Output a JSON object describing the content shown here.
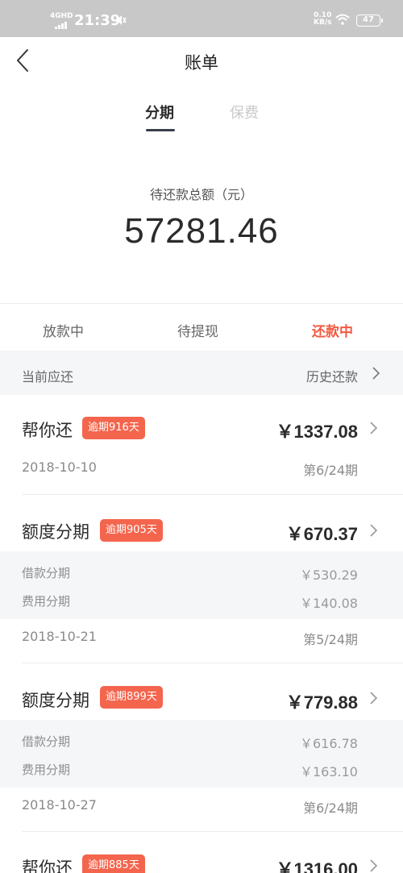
{
  "status_bar": {
    "network": "4GHD",
    "time": "21:39",
    "speed_value": "0.10",
    "speed_unit": "KB/s",
    "battery": "47"
  },
  "header": {
    "title": "账单"
  },
  "top_tabs": [
    {
      "label": "分期",
      "active": true
    },
    {
      "label": "保费",
      "active": false
    }
  ],
  "summary": {
    "label": "待还款总额（元）",
    "amount": "57281.46"
  },
  "status_tabs": [
    {
      "label": "放款中",
      "active": false
    },
    {
      "label": "待提现",
      "active": false
    },
    {
      "label": "还款中",
      "active": true
    }
  ],
  "current_section": {
    "label": "当前应还",
    "history_label": "历史还款"
  },
  "bills": [
    {
      "name": "帮你还",
      "badge": "逾期916天",
      "amount": "￥1337.08",
      "date": "2018-10-10",
      "period": "第6/24期"
    },
    {
      "name": "额度分期",
      "badge": "逾期905天",
      "amount": "￥670.37",
      "breakdown": [
        {
          "label": "借款分期",
          "value": "￥530.29"
        },
        {
          "label": "费用分期",
          "value": "￥140.08"
        }
      ],
      "date": "2018-10-21",
      "period": "第5/24期"
    },
    {
      "name": "额度分期",
      "badge": "逾期899天",
      "amount": "￥779.88",
      "breakdown": [
        {
          "label": "借款分期",
          "value": "￥616.78"
        },
        {
          "label": "费用分期",
          "value": "￥163.10"
        }
      ],
      "date": "2018-10-27",
      "period": "第6/24期"
    },
    {
      "name": "帮你还",
      "badge": "逾期885天",
      "amount": "￥1316.00"
    }
  ],
  "colors": {
    "accent": "#f05b43",
    "badge": "#f4654d",
    "status_bar": "#c8c8c8",
    "section_bg": "#f5f6f8"
  }
}
